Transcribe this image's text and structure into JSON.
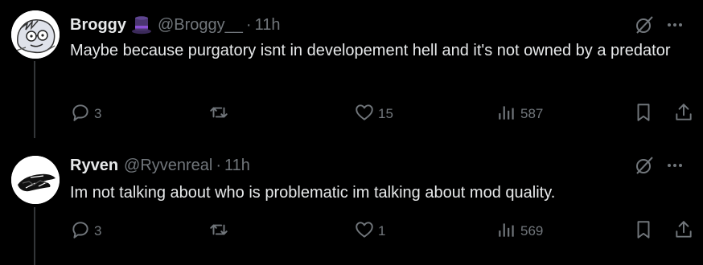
{
  "tweets": [
    {
      "display_name": "Broggy",
      "badge_icon": "top-hat-emoji",
      "handle": "@Broggy__",
      "separator": "·",
      "time": "11h",
      "text": "Maybe because purgatory isnt in developement hell and it's not owned by a predator",
      "replies": "3",
      "reposts": "",
      "likes": "15",
      "views": "587"
    },
    {
      "display_name": "Ryven",
      "handle": "@Ryvenreal",
      "separator": "·",
      "time": "11h",
      "text": "Im not talking about who is problematic im talking about mod quality.",
      "replies": "3",
      "reposts": "",
      "likes": "1",
      "views": "569"
    }
  ],
  "colors": {
    "background": "#000000",
    "primary_text": "#e7e9ea",
    "secondary_text": "#71767b",
    "thread_line": "#333639"
  },
  "icons": [
    "reply-icon",
    "repost-icon",
    "like-icon",
    "views-icon",
    "bookmark-icon",
    "share-icon",
    "grok-icon",
    "more-icon"
  ]
}
